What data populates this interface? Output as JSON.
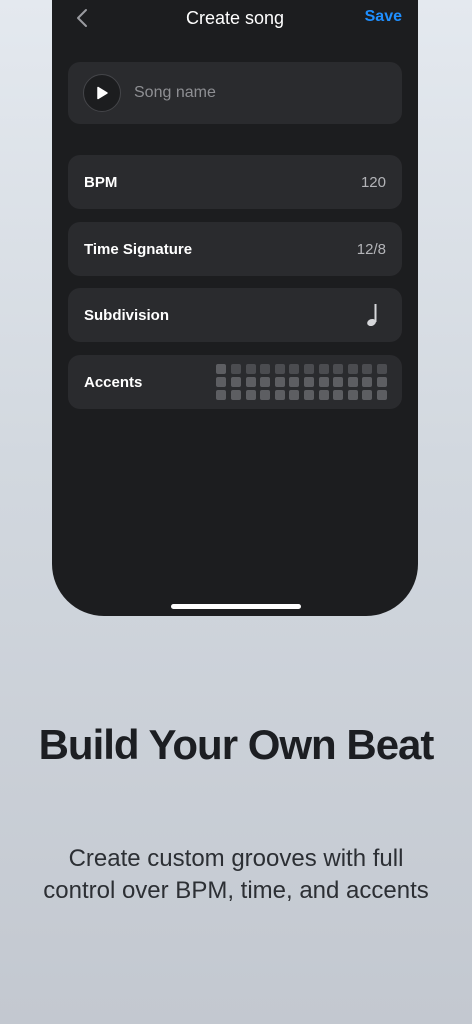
{
  "navbar": {
    "title": "Create song",
    "save_label": "Save",
    "back_icon": "chevron-left-icon"
  },
  "song": {
    "name_placeholder": "Song name",
    "play_icon": "play-icon"
  },
  "settings": {
    "bpm": {
      "label": "BPM",
      "value": "120"
    },
    "time_signature": {
      "label": "Time Signature",
      "value": "12/8"
    },
    "subdivision": {
      "label": "Subdivision",
      "icon": "quarter-note-icon"
    },
    "accents": {
      "label": "Accents",
      "beats": 12,
      "levels": 3,
      "accented_beats": [
        1
      ]
    }
  },
  "promo": {
    "headline": "Build Your Own Beat",
    "subtext": "Create custom grooves with full control over BPM, time, and accents"
  },
  "colors": {
    "accent": "#1f8fff",
    "phone_bg": "#1c1d1f",
    "card_bg": "#2a2b2e"
  }
}
